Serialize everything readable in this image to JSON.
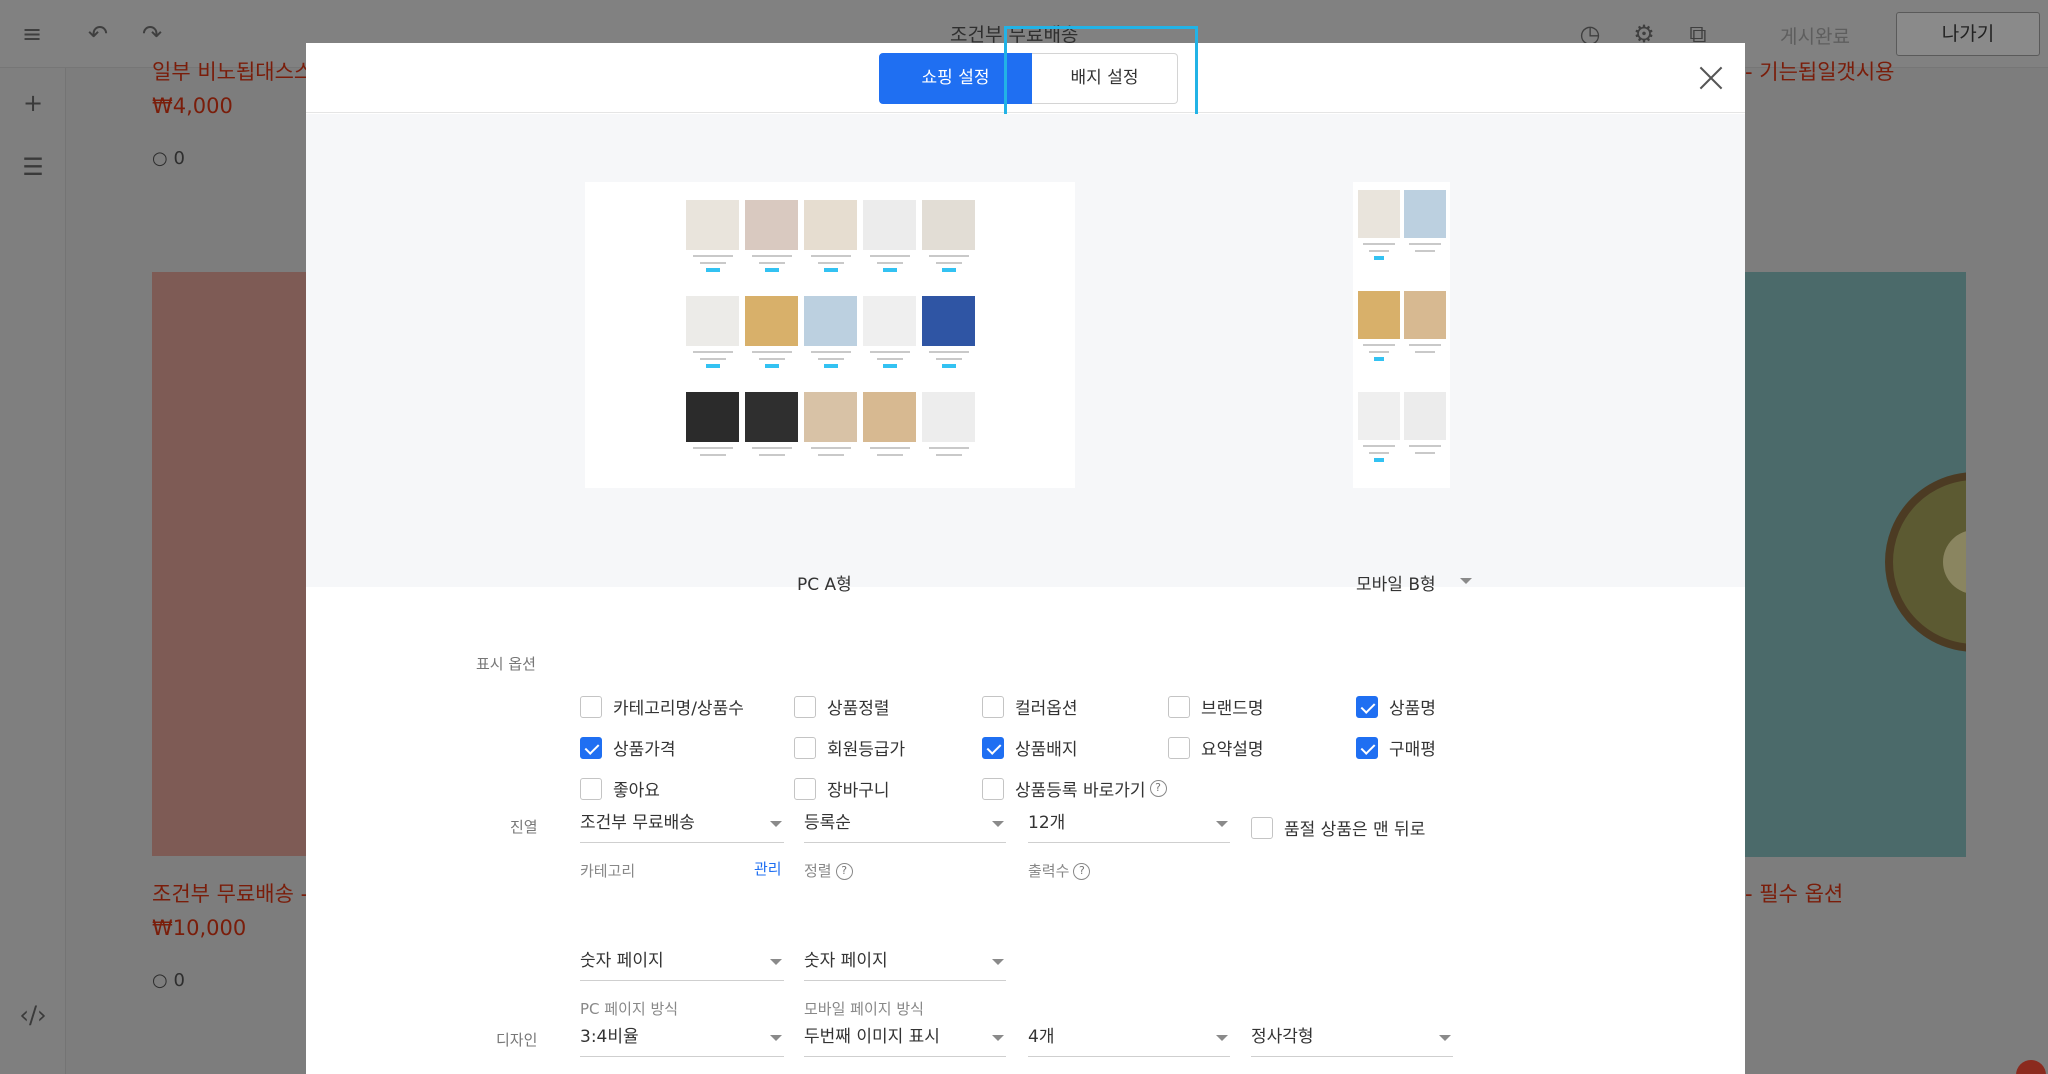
{
  "topbar": {
    "title": "조건부 무료배송",
    "publish_label": "게시완료",
    "exit_label": "나가기"
  },
  "background": {
    "items": [
      {
        "title": "일부 비노됩대스스",
        "price": "₩4,000",
        "comments": "0"
      },
      {
        "title": "조건부 무료배송 - ",
        "price": "₩10,000",
        "comments": "0"
      }
    ],
    "right_title_top": "- 기는됩일갯시용",
    "right_title": "- 필수 옵션"
  },
  "modal": {
    "tabs": [
      {
        "label": "쇼핑 설정",
        "active": true
      },
      {
        "label": "배지 설정",
        "active": false
      }
    ],
    "preview": {
      "pc_label": "PC A형",
      "mobile_label": "모바일 B형"
    },
    "display_options": {
      "label": "표시 옵션",
      "items": [
        {
          "label": "카테고리명/상품수",
          "checked": false
        },
        {
          "label": "상품정렬",
          "checked": false
        },
        {
          "label": "컬러옵션",
          "checked": false
        },
        {
          "label": "브랜드명",
          "checked": false
        },
        {
          "label": "상품명",
          "checked": true
        },
        {
          "label": "상품가격",
          "checked": true
        },
        {
          "label": "회원등급가",
          "checked": false
        },
        {
          "label": "상품배지",
          "checked": true
        },
        {
          "label": "요약설명",
          "checked": false
        },
        {
          "label": "구매평",
          "checked": true
        },
        {
          "label": "좋아요",
          "checked": false
        },
        {
          "label": "장바구니",
          "checked": false
        },
        {
          "label": "상품등록 바로가기",
          "checked": false
        }
      ]
    },
    "layout": {
      "label": "진열",
      "category_value": "조건부 무료배송",
      "category_sub": "카테고리",
      "manage_link": "관리",
      "sort_value": "등록순",
      "sort_sub": "정렬",
      "count_value": "12개",
      "count_sub": "출력수",
      "soldout_label": "품절 상품은 맨 뒤로",
      "soldout_checked": false,
      "pc_paging_value": "숫자 페이지",
      "pc_paging_sub": "PC 페이지 방식",
      "mobile_paging_value": "숫자 페이지",
      "mobile_paging_sub": "모바일 페이지 방식"
    },
    "design": {
      "label": "디자인",
      "ratio_value": "3:4비율",
      "image_value": "두번째 이미지 표시",
      "columns_value": "4개",
      "shape_value": "정사각형"
    }
  }
}
